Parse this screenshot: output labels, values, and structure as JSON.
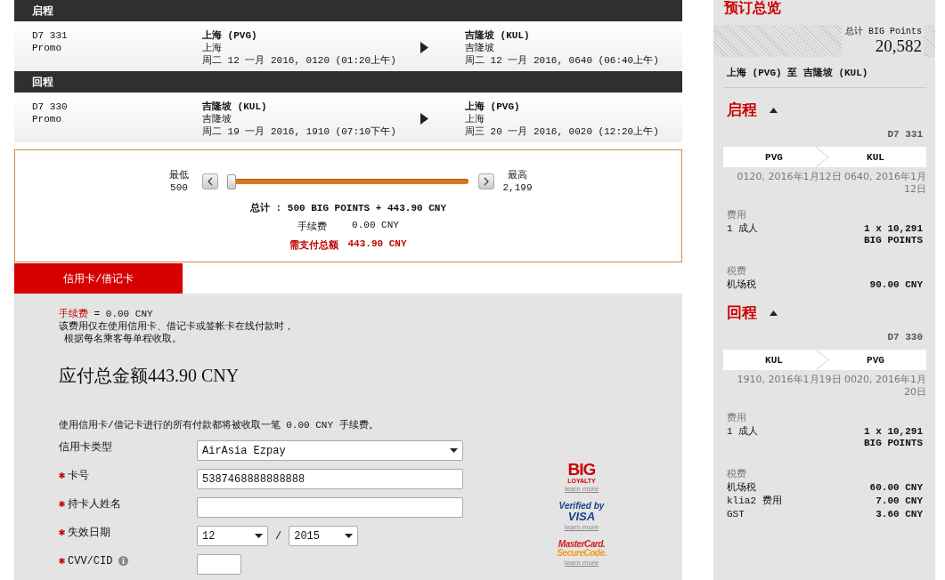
{
  "flights": [
    {
      "heading": "启程",
      "flight_no": "D7 331",
      "fare": "Promo",
      "departure": {
        "city": "上海 (PVG)",
        "city_short": "上海",
        "time": "周二 12 一月 2016, 0120 (01:20上午)"
      },
      "arrival": {
        "city": "吉隆坡 (KUL)",
        "city_short": "吉隆坡",
        "time": "周二 12 一月 2016, 0640 (06:40上午)"
      }
    },
    {
      "heading": "回程",
      "flight_no": "D7 330",
      "fare": "Promo",
      "departure": {
        "city": "吉隆坡 (KUL)",
        "city_short": "吉隆坡",
        "time": "周二 19 一月 2016, 1910 (07:10下午)"
      },
      "arrival": {
        "city": "上海 (PVG)",
        "city_short": "上海",
        "time": "周三 20 一月 2016, 0020 (12:20上午)"
      }
    }
  ],
  "points_slider": {
    "min_label": "最低",
    "min_value": "500",
    "max_label": "最高",
    "max_value": "2,199",
    "level": 0,
    "total_label": "总计",
    "total_value": ": 500 BIG POINTS + 443.90 CNY",
    "fee_label": "手续费",
    "fee_value": "0.00 CNY",
    "pay_label": "需支付总额",
    "pay_value": "443.90 CNY"
  },
  "payment_tabs": [
    {
      "label": "信用卡/借记卡",
      "selected": true
    }
  ],
  "payment": {
    "fee_label": "手续费",
    "fee_value": "= 0.00 CNY",
    "note_lines": [
      "该费用仅在使用信用卡、借记卡或签帐卡在线付款时，",
      "根据每名乘客每单程收取。"
    ],
    "total": "应付总金额443.90 CNY",
    "notice": "使用信用卡/借记卡进行的所有付款都将被收取一笔 0.00 CNY 手续费。",
    "fields": [
      {
        "kind": "select",
        "label": "信用卡类型",
        "required": false,
        "value": "AirAsia Ezpay"
      },
      {
        "kind": "text",
        "label": "卡号",
        "required": true,
        "value": "5387468888888888"
      },
      {
        "kind": "text",
        "label": "持卡人姓名",
        "required": true
      },
      {
        "kind": "date",
        "label": "失效日期",
        "required": true,
        "month": "12",
        "separator": "/",
        "year": "2015"
      },
      {
        "kind": "cvv",
        "label": "CVV/CID",
        "required": true
      }
    ],
    "badges": [
      {
        "kind": "big",
        "lines": [
          "BIG",
          "LOYALTY"
        ],
        "link": "learn more"
      },
      {
        "kind": "visa",
        "lines": [
          "Verified by",
          "VISA"
        ],
        "link": "learn more"
      },
      {
        "kind": "mastercard",
        "lines": [
          "MasterCard.",
          "SecureCode."
        ],
        "link": "learn more"
      }
    ]
  },
  "summary": {
    "title": "预订总览",
    "total_label": "总计 BIG Points",
    "total_value": "20,582",
    "route": "上海 (PVG) 至 吉隆坡 (KUL)",
    "legs": [
      {
        "heading": "启程",
        "expanded": true,
        "flight_no": "D7 331",
        "from": "PVG",
        "to": "KUL",
        "times": "0120, 2016年1月12日 0640, 2016年1月12日",
        "fare_label": "费用",
        "fares": [
          {
            "label": "1 成人",
            "value": "1 x 10,291 BIG POINTS"
          }
        ],
        "tax_label": "税费",
        "taxes": [
          {
            "label": "机场税",
            "value": "90.00 CNY"
          }
        ]
      },
      {
        "heading": "回程",
        "expanded": true,
        "flight_no": "D7 330",
        "from": "KUL",
        "to": "PVG",
        "times": "1910, 2016年1月19日 0020, 2016年1月20日",
        "fare_label": "费用",
        "fares": [
          {
            "label": "1 成人",
            "value": "1 x 10,291 BIG POINTS"
          }
        ],
        "tax_label": "税费",
        "taxes": [
          {
            "label": "机场税",
            "value": "60.00 CNY"
          },
          {
            "label": "klia2 费用",
            "value": "7.00 CNY"
          },
          {
            "label": "GST",
            "value": "3.60 CNY"
          }
        ]
      }
    ]
  }
}
